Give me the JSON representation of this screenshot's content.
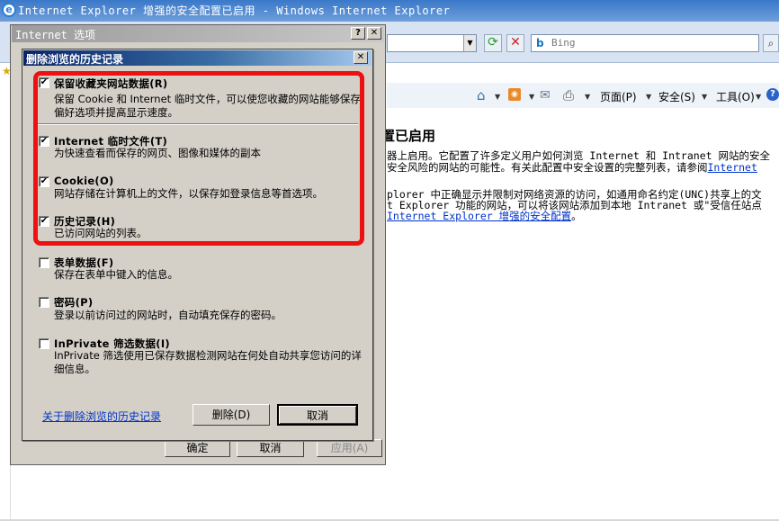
{
  "browser": {
    "title": "Internet Explorer 增强的安全配置已启用 - Windows Internet Explorer",
    "search_placeholder": "Bing",
    "commands": {
      "page": "页面(P)",
      "safety": "安全(S)",
      "tools": "工具(O)"
    }
  },
  "page": {
    "heading": "置已启用",
    "lines": [
      "器上启用。它配置了许多定义用户如何浏览 Internet 和 Intranet 网站的安全",
      "安全风险的网站的可能性。有关此配置中安全设置的完整列表，请参阅",
      "plorer 中正确显示并限制对网络资源的访问，如通用命名约定(UNC)共享上的文",
      "t Explorer 功能的网站，可以将该网站添加到本地 Intranet 或\"受信任站点"
    ],
    "link_internet": "Internet",
    "link_esc": " Internet Explorer 增强的安全配置",
    "link_esc_suffix": "。"
  },
  "options_dialog": {
    "title": "Internet 选项",
    "help_label": "?",
    "close_label": "✕",
    "ok_label": "确定",
    "cancel_label": "取消",
    "apply_label": "应用(A)"
  },
  "delete_dialog": {
    "title": "删除浏览的历史记录",
    "close_label": "✕",
    "options": [
      {
        "label": "保留收藏夹网站数据(R)",
        "desc": "保留 Cookie 和 Internet 临时文件，可以使您收藏的网站能够保存偏好选项并提高显示速度。",
        "checked": true
      },
      {
        "label": "Internet 临时文件(T)",
        "desc": "为快速查看而保存的网页、图像和媒体的副本",
        "checked": true
      },
      {
        "label": "Cookie(O)",
        "desc": "网站存储在计算机上的文件，以保存如登录信息等首选项。",
        "checked": true
      },
      {
        "label": "历史记录(H)",
        "desc": "已访问网站的列表。",
        "checked": true
      },
      {
        "label": "表单数据(F)",
        "desc": "保存在表单中键入的信息。",
        "checked": false
      },
      {
        "label": "密码(P)",
        "desc": "登录以前访问过的网站时，自动填充保存的密码。",
        "checked": false
      },
      {
        "label": "InPrivate 筛选数据(I)",
        "desc": "InPrivate 筛选使用已保存数据检测网站在何处自动共享您访问的详细信息。",
        "checked": false
      }
    ],
    "check_mark": "✔",
    "about_link": "关于删除浏览的历史记录",
    "delete_label": "删除(D)",
    "cancel_label": "取消"
  },
  "colors": {
    "highlight_box": "#ee1111",
    "title_active": "#0a246a",
    "link": "#0033cc"
  }
}
